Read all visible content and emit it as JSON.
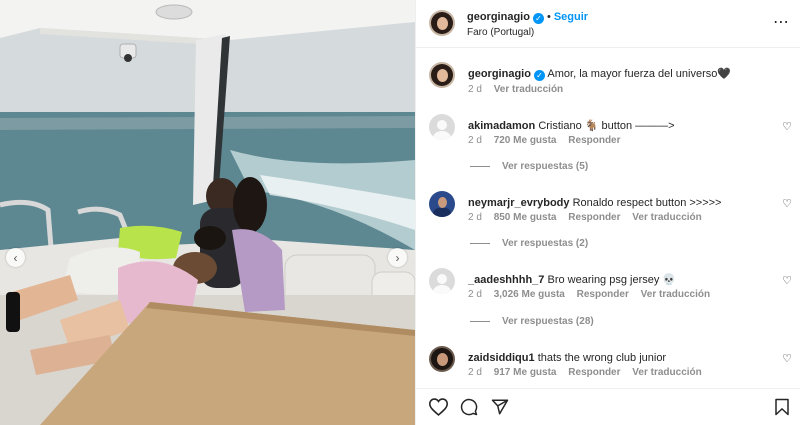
{
  "post": {
    "author": "georginagio",
    "follow_label": "Seguir",
    "location": "Faro (Portugal)",
    "caption": "Amor, la mayor fuerza del universo🖤",
    "time": "2 d",
    "translate_label": "Ver traducción",
    "icons": {
      "more": "more-options-icon",
      "verified": "verified-badge-icon",
      "like": "heart-icon",
      "comment": "comment-icon",
      "share": "share-icon",
      "save": "bookmark-icon",
      "prev": "chevron-left-icon",
      "next": "chevron-right-icon"
    }
  },
  "comments": [
    {
      "user": "akimadamon",
      "text": "Cristiano 🐐 button ———>",
      "time": "2 d",
      "likes": "720 Me gusta",
      "reply": "Responder",
      "translate": "",
      "replies": "Ver respuestas (5)"
    },
    {
      "user": "neymarjr_evrybody",
      "text": "Ronaldo respect button >>>>>",
      "time": "2 d",
      "likes": "850 Me gusta",
      "reply": "Responder",
      "translate": "Ver traducción",
      "replies": "Ver respuestas (2)"
    },
    {
      "user": "_aadeshhhh_7",
      "text": "Bro wearing psg jersey 💀",
      "time": "2 d",
      "likes": "3,026 Me gusta",
      "reply": "Responder",
      "translate": "Ver traducción",
      "replies": "Ver respuestas (28)"
    },
    {
      "user": "zaidsiddiqu1",
      "text": "thats the wrong club junior",
      "time": "2 d",
      "likes": "917 Me gusta",
      "reply": "Responder",
      "translate": "Ver traducción",
      "replies": ""
    }
  ],
  "colors": {
    "link_blue": "#0095f6",
    "text": "#262626",
    "muted": "#8e8e8e",
    "divider": "#efefef"
  }
}
